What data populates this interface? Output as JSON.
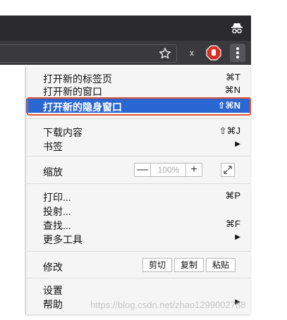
{
  "browser": {
    "icons": {
      "incognito": "incognito-icon",
      "bookmark": "star-icon",
      "extension_x": "x-extension-icon",
      "extension_stop": "stop-hand-icon",
      "menu": "vertical-dots-icon"
    },
    "extension_x_label": "x"
  },
  "menu": {
    "new_tab": {
      "label": "打开新的标签页",
      "shortcut": "⌘T"
    },
    "new_window": {
      "label": "打开新的窗口",
      "shortcut": "⌘N"
    },
    "new_incognito": {
      "label": "打开新的隐身窗口",
      "shortcut": "⇧⌘N"
    },
    "downloads": {
      "label": "下载内容",
      "shortcut": "⇧⌘J"
    },
    "bookmarks": {
      "label": "书签",
      "arrow": "▶"
    },
    "zoom": {
      "label": "缩放",
      "minus": "—",
      "value": "100%",
      "plus": "+"
    },
    "print": {
      "label": "打印...",
      "shortcut": "⌘P"
    },
    "cast": {
      "label": "投射..."
    },
    "find": {
      "label": "查找...",
      "shortcut": "⌘F"
    },
    "more_tools": {
      "label": "更多工具",
      "arrow": "▶"
    },
    "edit": {
      "label": "修改",
      "cut": "剪切",
      "copy": "复制",
      "paste": "粘贴"
    },
    "settings": {
      "label": "设置"
    },
    "help": {
      "label": "帮助",
      "arrow": "▶"
    }
  },
  "colors": {
    "highlight": "#2b67d3",
    "annotation_box": "#e05333",
    "toolbar_dark": "#3a3a3d"
  },
  "watermark": "https://blog.csdn.net/zhao1299002788"
}
